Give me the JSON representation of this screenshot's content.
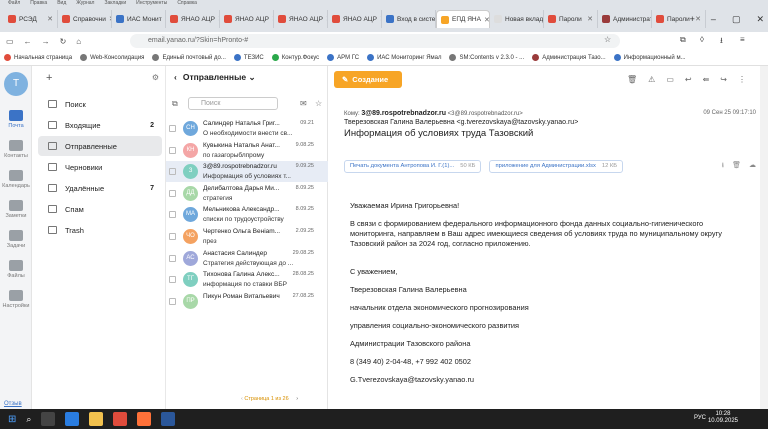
{
  "menubar": [
    "Файл",
    "Правка",
    "Вид",
    "Журнал",
    "Закладки",
    "Инструменты",
    "Справка"
  ],
  "tabs": [
    {
      "label": "РСЭД",
      "color": "#e04c3c"
    },
    {
      "label": "Справочни",
      "color": "#e04c3c"
    },
    {
      "label": "ИАС Монит",
      "color": "#3b73c6"
    },
    {
      "label": "ЯНАО АЦР",
      "color": "#e04c3c"
    },
    {
      "label": "ЯНАО АЦР",
      "color": "#e04c3c"
    },
    {
      "label": "ЯНАО АЦР",
      "color": "#e04c3c"
    },
    {
      "label": "ЯНАО АЦР",
      "color": "#e04c3c"
    },
    {
      "label": "Вход в систе",
      "color": "#3b73c6"
    },
    {
      "label": "ЕПД ЯНА",
      "color": "#f7a526",
      "active": true
    },
    {
      "label": "Новая вкладка",
      "color": "#dddddd"
    },
    {
      "label": "Пароли",
      "color": "#e04c3c"
    },
    {
      "label": "Администрат",
      "color": "#9a3b3b"
    },
    {
      "label": "Пароли",
      "color": "#e04c3c"
    }
  ],
  "address": {
    "url": "email.yanao.ru/?Skin=hPronto-#"
  },
  "bookmarks": [
    {
      "label": "Начальная страница",
      "color": "#e04c3c"
    },
    {
      "label": "Web-Консолидация",
      "color": "#777777"
    },
    {
      "label": "Единый почтовый до...",
      "color": "#777777"
    },
    {
      "label": "ТЕЗИС",
      "color": "#3b73c6"
    },
    {
      "label": "Контур.Фокус",
      "color": "#2aa84a"
    },
    {
      "label": "АРМ ГС",
      "color": "#3b73c6"
    },
    {
      "label": "ИАС Мониторинг Ямал",
      "color": "#3b73c6"
    },
    {
      "label": "SM:Contents v 2.3.0 - ...",
      "color": "#777777"
    },
    {
      "label": "Администрация Тазо...",
      "color": "#9a3b3b"
    },
    {
      "label": "Информационный м...",
      "color": "#3b73c6"
    }
  ],
  "rail": {
    "avatar": "Т",
    "items": [
      "Почта",
      "Контакты",
      "Календарь",
      "Заметки",
      "Задачи",
      "Файлы",
      "Настройки"
    ],
    "feedback": "Отзыв"
  },
  "folders": [
    {
      "label": "Поиск",
      "count": ""
    },
    {
      "label": "Входящие",
      "count": "2"
    },
    {
      "label": "Отправленные",
      "count": "",
      "active": true
    },
    {
      "label": "Черновики",
      "count": ""
    },
    {
      "label": "Удалённые",
      "count": "7"
    },
    {
      "label": "Спам",
      "count": ""
    },
    {
      "label": "Trash",
      "count": ""
    }
  ],
  "list": {
    "header": "Отправленные",
    "search_placeholder": "Поиск",
    "pager": "Страница 1 из 26",
    "messages": [
      {
        "initials": "СН",
        "color": "#6fa8dc",
        "from": "Салиндер Наталья Григ...",
        "date": "09.21",
        "subject": "О необходимости внести св..."
      },
      {
        "initials": "КН",
        "color": "#f4a6a6",
        "from": "Кувыкина Наталья Анат...",
        "date": "9.08.25",
        "subject": "по газагорыблпрому"
      },
      {
        "initials": "З",
        "color": "#7fcfc0",
        "from": "3@89.rospotrebnadzor.ru",
        "date": "9.09.25",
        "subject": "Информация об условиях т...",
        "sel": true
      },
      {
        "initials": "ДД",
        "color": "#a8d8a8",
        "from": "Делибалтова Дарья Ми...",
        "date": "8.09.25",
        "subject": "стратегия"
      },
      {
        "initials": "МА",
        "color": "#6fa8dc",
        "from": "Мельникова Александр...",
        "date": "8.09.25",
        "subject": "списки по трудоустройству"
      },
      {
        "initials": "ЧО",
        "color": "#f4a261",
        "from": "Чертенко Ольга Венiam...",
        "date": "2.09.25",
        "subject": "през"
      },
      {
        "initials": "АС",
        "color": "#9fa8da",
        "from": "Анастасия Салиндер",
        "date": "29.08.25",
        "subject": "Стратегия действующая до ..."
      },
      {
        "initials": "ТГ",
        "color": "#7fcfc0",
        "from": "Тихонова Галина Алекс...",
        "date": "28.08.25",
        "subject": "информация по ставки ВБР"
      },
      {
        "initials": "ПР",
        "color": "#a8d8a8",
        "from": "Пикун Роман Витальевич",
        "date": "27.08.25",
        "subject": ""
      }
    ]
  },
  "reader": {
    "create_label": "Создание",
    "to_label": "Кому:",
    "to_name": "3@89.rospotrebnadzor.ru",
    "to_addr": "<3@89.rospotrebnadzor.ru>",
    "date": "09 Сен 25 09:17:10",
    "sender": "Тверезовская Галина Валерьевна <g.tverezovskaya@tazovsky.yanao.ru>",
    "subject": "Информация об условиях труда Тазовский",
    "attachments": [
      {
        "name": "Печать документа Антропова И. Г.(1)...",
        "size": "50 КБ"
      },
      {
        "name": "приложение для Администрации.xlsx",
        "size": "12 КБ"
      }
    ],
    "body": [
      "Уважаемая Ирина Григорьевна!",
      "В связи с формированием федерального информационного фонда данных социально-гигиенического мониторинга, направляем в Ваш адрес имеющиеся сведения об условиях труда по муниципальному округу Тазовский район за 2024 год, согласно приложению.",
      "С уважением,",
      "Тверезовская Галина Валерьевна",
      "начальник отдела экономического прогнозирования",
      "управления социально-экономического развития",
      "Администрации Тазовского района",
      "8 (349 40) 2-04-48, +7 992 402 0502",
      "G.Tverezovskaya@tazovsky.yanao.ru"
    ]
  },
  "taskbar": {
    "lang": "РУС",
    "time": "10:28",
    "date": "10.09.2025"
  }
}
